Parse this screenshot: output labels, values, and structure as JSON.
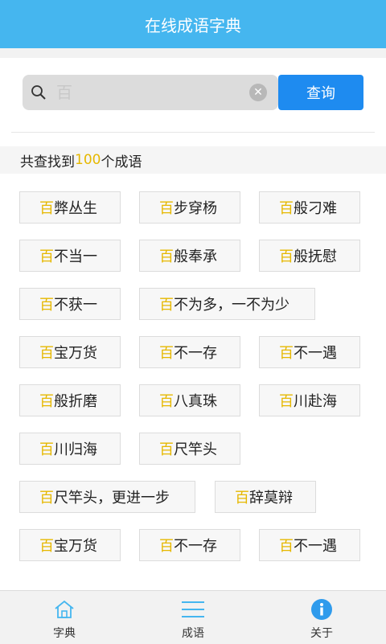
{
  "header": {
    "title": "在线成语字典"
  },
  "search": {
    "value": "百",
    "clear_icon": "clear-icon",
    "button_label": "查询"
  },
  "summary": {
    "prefix": "共查找到",
    "count": "100",
    "suffix": "个成语"
  },
  "highlight_color": "#e6b800",
  "results": [
    {
      "first": "百",
      "rest": "弊丛生"
    },
    {
      "first": "百",
      "rest": "步穿杨"
    },
    {
      "first": "百",
      "rest": "般刁难"
    },
    {
      "first": "百",
      "rest": "不当一"
    },
    {
      "first": "百",
      "rest": "般奉承"
    },
    {
      "first": "百",
      "rest": "般抚慰"
    },
    {
      "first": "百",
      "rest": "不获一"
    },
    {
      "first": "百",
      "rest": "不为多，一不为少"
    },
    {
      "first": "百",
      "rest": "宝万货"
    },
    {
      "first": "百",
      "rest": "不一存"
    },
    {
      "first": "百",
      "rest": "不一遇"
    },
    {
      "first": "百",
      "rest": "般折磨"
    },
    {
      "first": "百",
      "rest": "八真珠"
    },
    {
      "first": "百",
      "rest": "川赴海"
    },
    {
      "first": "百",
      "rest": "川归海"
    },
    {
      "first": "百",
      "rest": "尺竿头"
    },
    {
      "first": "百",
      "rest": "尺竿头，更进一步"
    },
    {
      "first": "百",
      "rest": "辞莫辩"
    },
    {
      "first": "百",
      "rest": "宝万货"
    },
    {
      "first": "百",
      "rest": "不一存"
    },
    {
      "first": "百",
      "rest": "不一遇"
    }
  ],
  "tabs": [
    {
      "label": "字典",
      "icon": "home-icon"
    },
    {
      "label": "成语",
      "icon": "menu-icon"
    },
    {
      "label": "关于",
      "icon": "info-icon"
    }
  ]
}
